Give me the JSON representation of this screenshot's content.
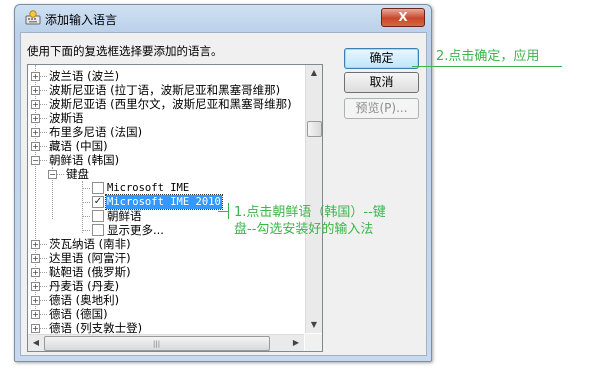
{
  "dialog": {
    "title": "添加输入语言",
    "close_label": "X",
    "instruction": "使用下面的复选框选择要添加的语言。",
    "buttons": {
      "ok": "确定",
      "cancel": "取消",
      "preview": "预览(P)..."
    }
  },
  "tree": {
    "items_top": [
      "波兰语 (波兰)",
      "波斯尼亚语 (拉丁语，波斯尼亚和黑塞哥维那)",
      "波斯尼亚语 (西里尔文，波斯尼亚和黑塞哥维那)",
      "波斯语",
      "布里多尼语 (法国)",
      "藏语 (中国)",
      "朝鲜语 (韩国)"
    ],
    "keyboard_node": "键盘",
    "keyboard_options": [
      {
        "label": "Microsoft IME",
        "checked": false
      },
      {
        "label": "Microsoft IME 2010",
        "checked": true
      },
      {
        "label": "朝鲜语",
        "checked": false
      }
    ],
    "show_more": "显示更多...",
    "items_bottom": [
      "茨瓦纳语 (南非)",
      "达里语 (阿富汗)",
      "鞑靼语 (俄罗斯)",
      "丹麦语 (丹麦)",
      "德语 (奥地利)",
      "德语 (德国)",
      "德语 (列支敦士登)"
    ],
    "expand_symbol": "+",
    "collapse_symbol": "−"
  },
  "annotations": {
    "ok_note": "2.点击确定，应用",
    "keyboard_note_line1": "1.点击朝鲜语（韩国）--键",
    "keyboard_note_line2": "盘--勾选安装好的输入法",
    "accent_color": "#3cb54a"
  }
}
